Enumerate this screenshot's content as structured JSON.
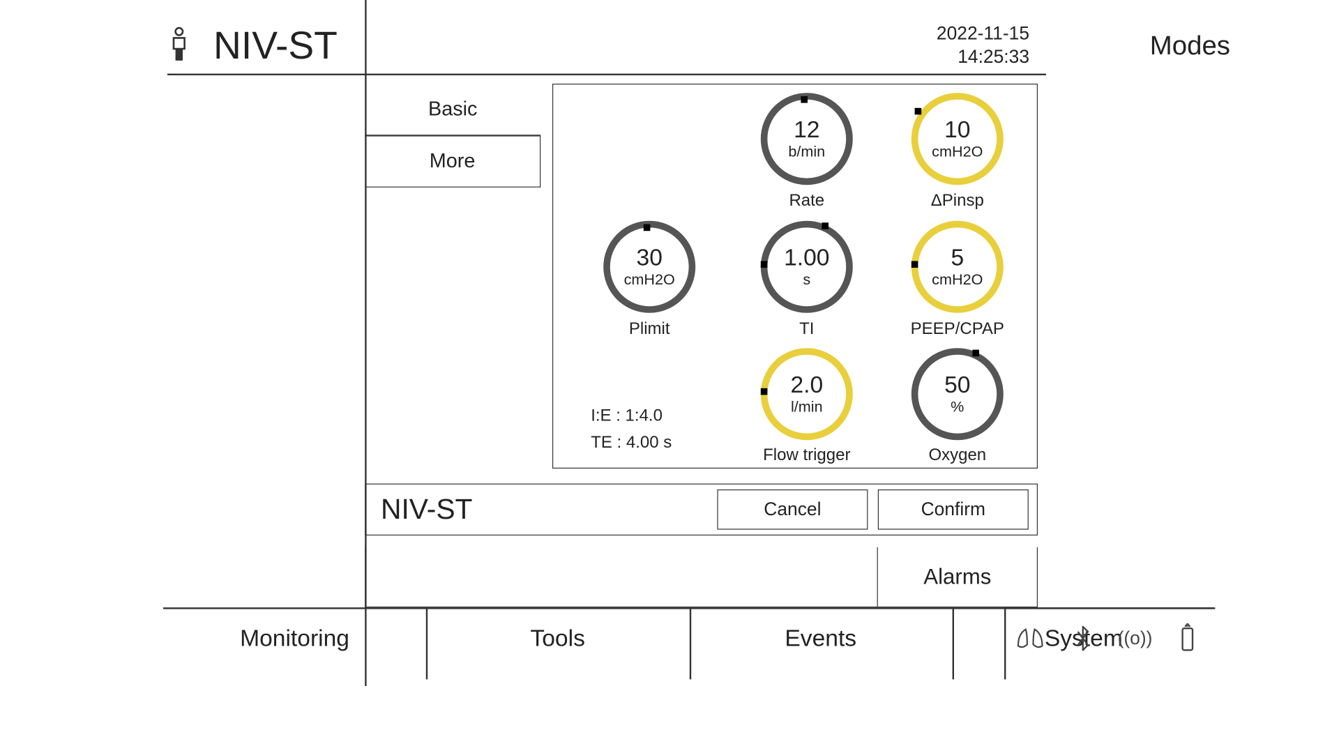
{
  "header": {
    "mode_title": "NIV-ST",
    "date": "2022-11-15",
    "time": "14:25:33",
    "modes_label": "Modes"
  },
  "side_tabs": {
    "basic": "Basic",
    "more": "More"
  },
  "dials": {
    "rate": {
      "value": "12",
      "unit": "b/min",
      "label": "Rate",
      "color": "grey"
    },
    "dpinsp": {
      "value": "10",
      "unit": "cmH2O",
      "label": "ΔPinsp",
      "color": "yellow"
    },
    "plimit": {
      "value": "30",
      "unit": "cmH2O",
      "label": "Plimit",
      "color": "grey"
    },
    "ti": {
      "value": "1.00",
      "unit": "s",
      "label": "TI",
      "color": "grey"
    },
    "peep": {
      "value": "5",
      "unit": "cmH2O",
      "label": "PEEP/CPAP",
      "color": "yellow"
    },
    "flow": {
      "value": "2.0",
      "unit": "l/min",
      "label": "Flow trigger",
      "color": "yellow"
    },
    "oxygen": {
      "value": "50",
      "unit": "%",
      "label": "Oxygen",
      "color": "grey"
    }
  },
  "readouts": {
    "ie": "I:E : 1:4.0",
    "te": "TE : 4.00 s"
  },
  "mode_bar": {
    "title": "NIV-ST",
    "cancel": "Cancel",
    "confirm": "Confirm"
  },
  "alarms_label": "Alarms",
  "bottom_tabs": {
    "monitoring": "Monitoring",
    "tools": "Tools",
    "events": "Events",
    "system": "System"
  },
  "status_icons": [
    "lungs-icon",
    "bluetooth-icon",
    "wireless-icon",
    "battery-icon"
  ]
}
